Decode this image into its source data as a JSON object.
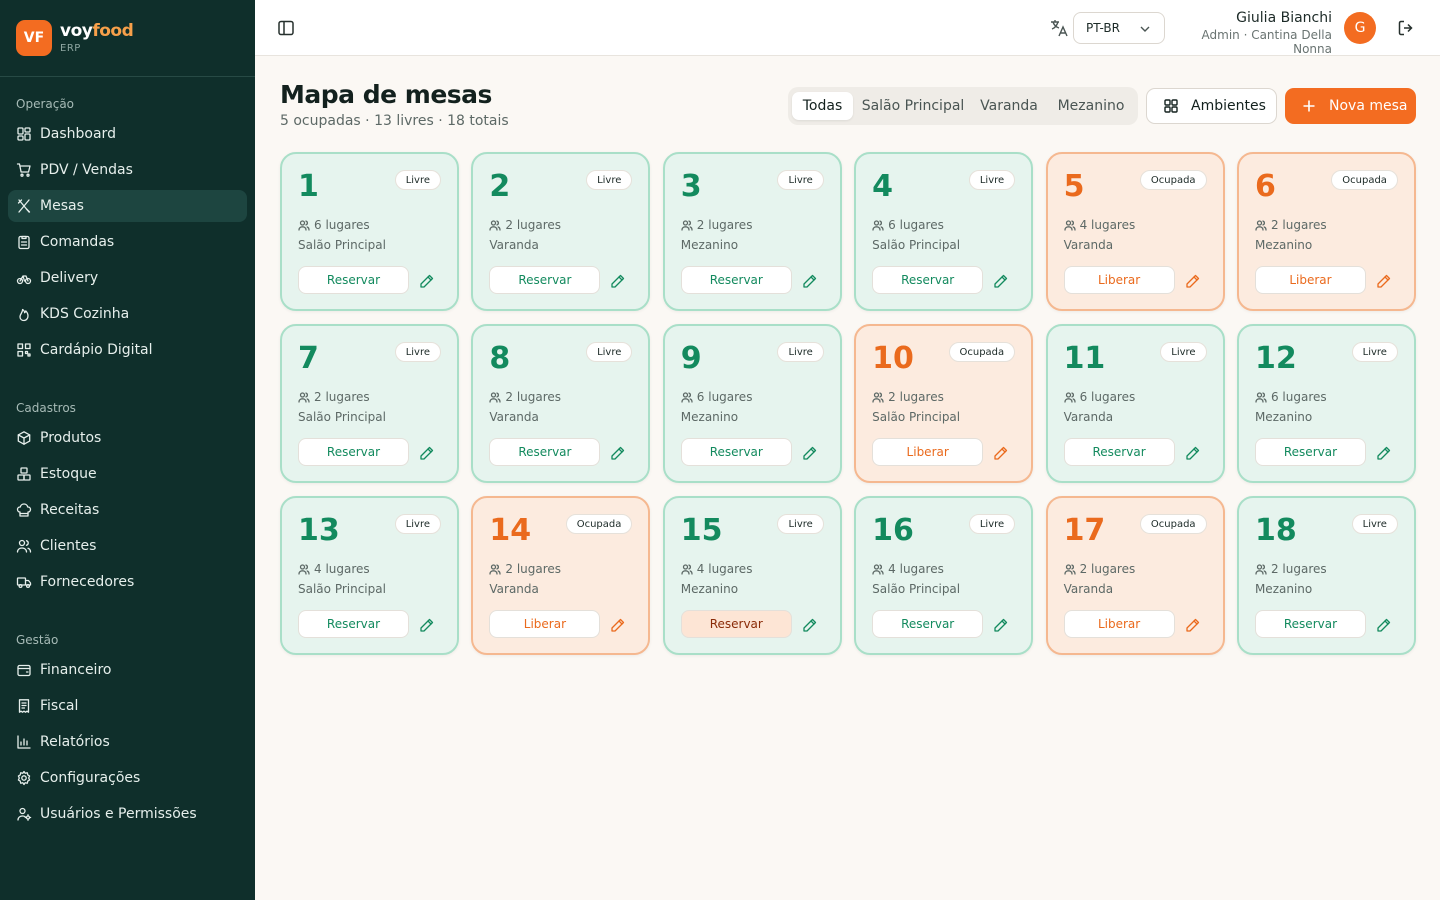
{
  "brand": {
    "badge": "VF",
    "name_a": "voy",
    "name_b": "food",
    "sub": "ERP"
  },
  "sidebar": {
    "sections": [
      {
        "title": "Operação",
        "items": [
          {
            "label": "Dashboard",
            "icon": "dashboard-icon"
          },
          {
            "label": "PDV / Vendas",
            "icon": "cart-icon"
          },
          {
            "label": "Mesas",
            "icon": "utensils-icon",
            "active": true
          },
          {
            "label": "Comandas",
            "icon": "clipboard-icon"
          },
          {
            "label": "Delivery",
            "icon": "bike-icon"
          },
          {
            "label": "KDS Cozinha",
            "icon": "flame-icon"
          },
          {
            "label": "Cardápio Digital",
            "icon": "qrcode-icon"
          }
        ]
      },
      {
        "title": "Cadastros",
        "items": [
          {
            "label": "Produtos",
            "icon": "package-icon"
          },
          {
            "label": "Estoque",
            "icon": "boxes-icon"
          },
          {
            "label": "Receitas",
            "icon": "chef-hat-icon"
          },
          {
            "label": "Clientes",
            "icon": "users-icon"
          },
          {
            "label": "Fornecedores",
            "icon": "truck-icon"
          }
        ]
      },
      {
        "title": "Gestão",
        "items": [
          {
            "label": "Financeiro",
            "icon": "wallet-icon"
          },
          {
            "label": "Fiscal",
            "icon": "receipt-icon"
          },
          {
            "label": "Relatórios",
            "icon": "bar-chart-icon"
          },
          {
            "label": "Configurações",
            "icon": "gear-icon"
          },
          {
            "label": "Usuários e Permissões",
            "icon": "user-cog-icon"
          }
        ]
      }
    ]
  },
  "topbar": {
    "language": "PT-BR",
    "user_name": "Giulia Bianchi",
    "user_role": "Admin · Cantina Della Nonna",
    "avatar_initial": "G"
  },
  "page": {
    "title": "Mapa de mesas",
    "subtitle": "5 ocupadas · 13 livres · 18 totais",
    "filters": [
      "Todas",
      "Salão Principal",
      "Varanda",
      "Mezanino"
    ],
    "active_filter": "Todas",
    "ambientes_label": "Ambientes",
    "new_table_label": "Nova mesa"
  },
  "tables": [
    {
      "number": "1",
      "status": "Livre",
      "seats": "6 lugares",
      "area": "Salão Principal",
      "action": "Reservar"
    },
    {
      "number": "2",
      "status": "Livre",
      "seats": "2 lugares",
      "area": "Varanda",
      "action": "Reservar"
    },
    {
      "number": "3",
      "status": "Livre",
      "seats": "2 lugares",
      "area": "Mezanino",
      "action": "Reservar"
    },
    {
      "number": "4",
      "status": "Livre",
      "seats": "6 lugares",
      "area": "Salão Principal",
      "action": "Reservar"
    },
    {
      "number": "5",
      "status": "Ocupada",
      "seats": "4 lugares",
      "area": "Varanda",
      "action": "Liberar"
    },
    {
      "number": "6",
      "status": "Ocupada",
      "seats": "2 lugares",
      "area": "Mezanino",
      "action": "Liberar"
    },
    {
      "number": "7",
      "status": "Livre",
      "seats": "2 lugares",
      "area": "Salão Principal",
      "action": "Reservar"
    },
    {
      "number": "8",
      "status": "Livre",
      "seats": "2 lugares",
      "area": "Varanda",
      "action": "Reservar"
    },
    {
      "number": "9",
      "status": "Livre",
      "seats": "6 lugares",
      "area": "Mezanino",
      "action": "Reservar"
    },
    {
      "number": "10",
      "status": "Ocupada",
      "seats": "2 lugares",
      "area": "Salão Principal",
      "action": "Liberar"
    },
    {
      "number": "11",
      "status": "Livre",
      "seats": "6 lugares",
      "area": "Varanda",
      "action": "Reservar"
    },
    {
      "number": "12",
      "status": "Livre",
      "seats": "6 lugares",
      "area": "Mezanino",
      "action": "Reservar"
    },
    {
      "number": "13",
      "status": "Livre",
      "seats": "4 lugares",
      "area": "Salão Principal",
      "action": "Reservar"
    },
    {
      "number": "14",
      "status": "Ocupada",
      "seats": "2 lugares",
      "area": "Varanda",
      "action": "Liberar"
    },
    {
      "number": "15",
      "status": "Livre",
      "seats": "4 lugares",
      "area": "Mezanino",
      "action": "Reservar",
      "hover": true
    },
    {
      "number": "16",
      "status": "Livre",
      "seats": "4 lugares",
      "area": "Salão Principal",
      "action": "Reservar"
    },
    {
      "number": "17",
      "status": "Ocupada",
      "seats": "2 lugares",
      "area": "Varanda",
      "action": "Liberar"
    },
    {
      "number": "18",
      "status": "Livre",
      "seats": "2 lugares",
      "area": "Mezanino",
      "action": "Reservar"
    }
  ],
  "colors": {
    "free": "#138a5e",
    "occupied": "#ea6a1d",
    "sidebar": "#0f2f2b",
    "accent": "#f36c21"
  }
}
